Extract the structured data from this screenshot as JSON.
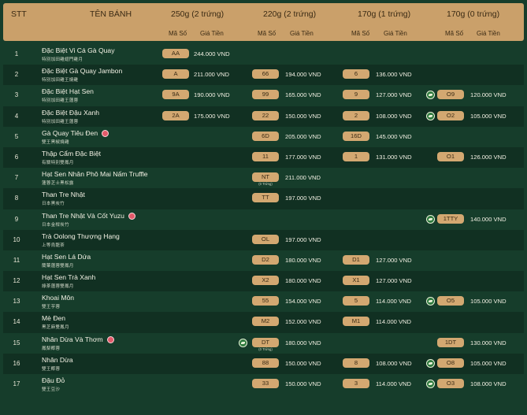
{
  "header": {
    "stt": "STT",
    "name": "TÊN BÁNH",
    "groups": [
      "250g (2 trứng)",
      "220g (2 trứng)",
      "170g (1 trứng)",
      "170g (0 trứng)"
    ],
    "code_label": "Mã Số",
    "price_label": "Giá Tiền"
  },
  "rows": [
    {
      "stt": "1",
      "name": "Đặc Biệt Vi Cá Gà Quay",
      "cn": "特別加田雞翅門雞月",
      "badge": false,
      "c1": "AA",
      "p1": "244.000 VND",
      "c2": "",
      "p2": "",
      "c3": "",
      "p3": "",
      "c4": "",
      "p4": "",
      "v4": false
    },
    {
      "stt": "2",
      "name": "Đặc Biệt Gà Quay Jambon",
      "cn": "特別加田雞王燒雞",
      "badge": false,
      "c1": "A",
      "p1": "211.000 VND",
      "c2": "66",
      "p2": "194.000 VND",
      "c3": "6",
      "p3": "136.000 VND",
      "c4": "",
      "p4": "",
      "v4": false
    },
    {
      "stt": "3",
      "name": "Đặc Biệt Hạt Sen",
      "cn": "特別加田雞王蓮蓉",
      "badge": false,
      "c1": "9A",
      "p1": "190.000 VND",
      "c2": "99",
      "p2": "165.000 VND",
      "c3": "9",
      "p3": "127.000 VND",
      "c4": "O9",
      "p4": "120.000 VND",
      "v4": true
    },
    {
      "stt": "4",
      "name": "Đặc Biệt Đậu Xanh",
      "cn": "特別加田雞王蓮蓉",
      "badge": false,
      "c1": "2A",
      "p1": "175.000 VND",
      "c2": "22",
      "p2": "150.000 VND",
      "c3": "2",
      "p3": "108.000 VND",
      "c4": "O2",
      "p4": "105.000 VND",
      "v4": true
    },
    {
      "stt": "5",
      "name": "Gà Quay Tiêu Đen",
      "cn": "雙王黑椒燒雞",
      "badge": true,
      "c1": "",
      "p1": "",
      "c2": "6D",
      "p2": "205.000 VND",
      "c3": "16D",
      "p3": "145.000 VND",
      "c4": "",
      "p4": "",
      "v4": false
    },
    {
      "stt": "6",
      "name": "Thập Cẩm Đặc Biệt",
      "cn": "有關特別雙鳳月",
      "badge": false,
      "c1": "",
      "p1": "",
      "c2": "11",
      "p2": "177.000 VND",
      "c3": "1",
      "p3": "131.000 VND",
      "c4": "O1",
      "p4": "126.000 VND",
      "v4": false
    },
    {
      "stt": "7",
      "name": "Hạt Sen Nhân Phô Mai Nấm Truffle",
      "cn": "蓮蓉芝士黑松露",
      "badge": false,
      "c1": "",
      "p1": "",
      "c2": "NT",
      "sub2": "(0 Trứng)",
      "p2": "211.000 VND",
      "c3": "",
      "p3": "",
      "c4": "",
      "p4": "",
      "v4": false
    },
    {
      "stt": "8",
      "name": "Than Tre Nhật",
      "cn": "日本黑炭竹",
      "badge": false,
      "c1": "",
      "p1": "",
      "c2": "TT",
      "p2": "197.000 VND",
      "c3": "",
      "p3": "",
      "c4": "",
      "p4": "",
      "v4": false
    },
    {
      "stt": "9",
      "name": "Than Tre Nhật Và Cốt Yuzu",
      "cn": "日本金柑炭竹",
      "badge": true,
      "c1": "",
      "p1": "",
      "c2": "",
      "p2": "",
      "c3": "",
      "p3": "",
      "c4": "1TTY",
      "p4": "140.000 VND",
      "v4": true
    },
    {
      "stt": "10",
      "name": "Trà Oolong Thượng Hạng",
      "cn": "上等烏龍茶",
      "badge": false,
      "c1": "",
      "p1": "",
      "c2": "OL",
      "p2": "197.000 VND",
      "c3": "",
      "p3": "",
      "c4": "",
      "p4": "",
      "v4": false
    },
    {
      "stt": "11",
      "name": "Hạt Sen Lá Dứa",
      "cn": "蘭葉蓮蓉雙鳳月",
      "badge": false,
      "c1": "",
      "p1": "",
      "c2": "D2",
      "p2": "180.000 VND",
      "c3": "D1",
      "p3": "127.000 VND",
      "c4": "",
      "p4": "",
      "v4": false
    },
    {
      "stt": "12",
      "name": "Hạt Sen Trà Xanh",
      "cn": "綠茶蓮蓉雙鳳月",
      "badge": false,
      "c1": "",
      "p1": "",
      "c2": "X2",
      "p2": "180.000 VND",
      "c3": "X1",
      "p3": "127.000 VND",
      "c4": "",
      "p4": "",
      "v4": false
    },
    {
      "stt": "13",
      "name": "Khoai Môn",
      "cn": "雙王芋蓉",
      "badge": false,
      "c1": "",
      "p1": "",
      "c2": "55",
      "p2": "154.000 VND",
      "c3": "5",
      "p3": "114.000 VND",
      "c4": "O5",
      "p4": "105.000 VND",
      "v4": true
    },
    {
      "stt": "14",
      "name": "Mè Đen",
      "cn": "黑芝麻雙鳳月",
      "badge": false,
      "c1": "",
      "p1": "",
      "c2": "M2",
      "p2": "152.000 VND",
      "c3": "M1",
      "p3": "114.000 VND",
      "c4": "",
      "p4": "",
      "v4": false
    },
    {
      "stt": "15",
      "name": "Nhân Dừa Và Thơm",
      "cn": "鳳梨椰蓉",
      "badge": true,
      "c1": "",
      "p1": "",
      "c2": "DT",
      "sub2": "(0 Trứng)",
      "v2": true,
      "p2": "180.000 VND",
      "c3": "",
      "p3": "",
      "c4": "1DT",
      "p4": "130.000 VND",
      "v4": false
    },
    {
      "stt": "16",
      "name": "Nhân Dừa",
      "cn": "雙王椰蓉",
      "badge": false,
      "c1": "",
      "p1": "",
      "c2": "88",
      "p2": "150.000 VND",
      "c3": "8",
      "p3": "108.000 VND",
      "c4": "O8",
      "p4": "105.000 VND",
      "v4": true
    },
    {
      "stt": "17",
      "name": "Đậu Đỏ",
      "cn": "雙王豆沙",
      "badge": false,
      "c1": "",
      "p1": "",
      "c2": "33",
      "p2": "150.000 VND",
      "c3": "3",
      "p3": "114.000 VND",
      "c4": "O3",
      "p4": "108.000 VND",
      "v4": true
    }
  ],
  "colors": {
    "background": "#163d2b",
    "header": "#caa06a",
    "pill": "#d3a871",
    "veg_icon": "#2f7a3f"
  }
}
